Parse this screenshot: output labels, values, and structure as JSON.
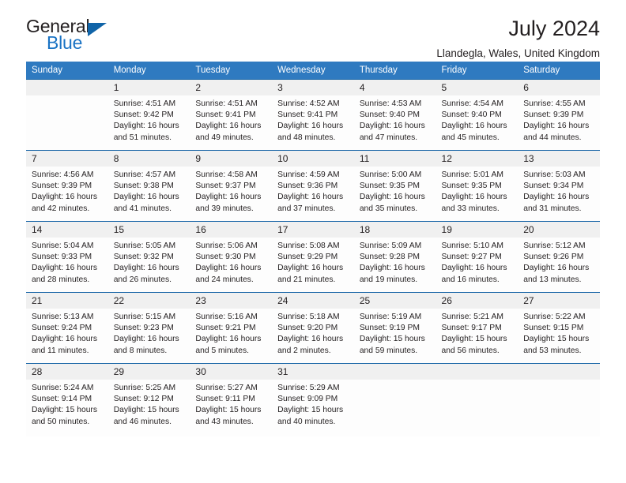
{
  "brand": {
    "name_part1": "General",
    "name_part2": "Blue",
    "triangle_color": "#1064a8",
    "blue_color": "#1a73c4"
  },
  "header": {
    "title": "July 2024",
    "subtitle": "Llandegla, Wales, United Kingdom"
  },
  "theme": {
    "header_row_bg": "#2f7ac0",
    "row_border": "#1764a6",
    "daynum_bg": "#f0f0f0",
    "text": "#231f20"
  },
  "labels": {
    "sunrise_prefix": "Sunrise:",
    "sunset_prefix": "Sunset:",
    "daylight_prefix": "Daylight:"
  },
  "weekdays": [
    "Sunday",
    "Monday",
    "Tuesday",
    "Wednesday",
    "Thursday",
    "Friday",
    "Saturday"
  ],
  "weeks": [
    [
      {
        "day": "",
        "sunrise": "",
        "sunset": "",
        "daylight_line1": "",
        "daylight_line2": ""
      },
      {
        "day": "1",
        "sunrise": "Sunrise: 4:51 AM",
        "sunset": "Sunset: 9:42 PM",
        "daylight_line1": "Daylight: 16 hours",
        "daylight_line2": "and 51 minutes."
      },
      {
        "day": "2",
        "sunrise": "Sunrise: 4:51 AM",
        "sunset": "Sunset: 9:41 PM",
        "daylight_line1": "Daylight: 16 hours",
        "daylight_line2": "and 49 minutes."
      },
      {
        "day": "3",
        "sunrise": "Sunrise: 4:52 AM",
        "sunset": "Sunset: 9:41 PM",
        "daylight_line1": "Daylight: 16 hours",
        "daylight_line2": "and 48 minutes."
      },
      {
        "day": "4",
        "sunrise": "Sunrise: 4:53 AM",
        "sunset": "Sunset: 9:40 PM",
        "daylight_line1": "Daylight: 16 hours",
        "daylight_line2": "and 47 minutes."
      },
      {
        "day": "5",
        "sunrise": "Sunrise: 4:54 AM",
        "sunset": "Sunset: 9:40 PM",
        "daylight_line1": "Daylight: 16 hours",
        "daylight_line2": "and 45 minutes."
      },
      {
        "day": "6",
        "sunrise": "Sunrise: 4:55 AM",
        "sunset": "Sunset: 9:39 PM",
        "daylight_line1": "Daylight: 16 hours",
        "daylight_line2": "and 44 minutes."
      }
    ],
    [
      {
        "day": "7",
        "sunrise": "Sunrise: 4:56 AM",
        "sunset": "Sunset: 9:39 PM",
        "daylight_line1": "Daylight: 16 hours",
        "daylight_line2": "and 42 minutes."
      },
      {
        "day": "8",
        "sunrise": "Sunrise: 4:57 AM",
        "sunset": "Sunset: 9:38 PM",
        "daylight_line1": "Daylight: 16 hours",
        "daylight_line2": "and 41 minutes."
      },
      {
        "day": "9",
        "sunrise": "Sunrise: 4:58 AM",
        "sunset": "Sunset: 9:37 PM",
        "daylight_line1": "Daylight: 16 hours",
        "daylight_line2": "and 39 minutes."
      },
      {
        "day": "10",
        "sunrise": "Sunrise: 4:59 AM",
        "sunset": "Sunset: 9:36 PM",
        "daylight_line1": "Daylight: 16 hours",
        "daylight_line2": "and 37 minutes."
      },
      {
        "day": "11",
        "sunrise": "Sunrise: 5:00 AM",
        "sunset": "Sunset: 9:35 PM",
        "daylight_line1": "Daylight: 16 hours",
        "daylight_line2": "and 35 minutes."
      },
      {
        "day": "12",
        "sunrise": "Sunrise: 5:01 AM",
        "sunset": "Sunset: 9:35 PM",
        "daylight_line1": "Daylight: 16 hours",
        "daylight_line2": "and 33 minutes."
      },
      {
        "day": "13",
        "sunrise": "Sunrise: 5:03 AM",
        "sunset": "Sunset: 9:34 PM",
        "daylight_line1": "Daylight: 16 hours",
        "daylight_line2": "and 31 minutes."
      }
    ],
    [
      {
        "day": "14",
        "sunrise": "Sunrise: 5:04 AM",
        "sunset": "Sunset: 9:33 PM",
        "daylight_line1": "Daylight: 16 hours",
        "daylight_line2": "and 28 minutes."
      },
      {
        "day": "15",
        "sunrise": "Sunrise: 5:05 AM",
        "sunset": "Sunset: 9:32 PM",
        "daylight_line1": "Daylight: 16 hours",
        "daylight_line2": "and 26 minutes."
      },
      {
        "day": "16",
        "sunrise": "Sunrise: 5:06 AM",
        "sunset": "Sunset: 9:30 PM",
        "daylight_line1": "Daylight: 16 hours",
        "daylight_line2": "and 24 minutes."
      },
      {
        "day": "17",
        "sunrise": "Sunrise: 5:08 AM",
        "sunset": "Sunset: 9:29 PM",
        "daylight_line1": "Daylight: 16 hours",
        "daylight_line2": "and 21 minutes."
      },
      {
        "day": "18",
        "sunrise": "Sunrise: 5:09 AM",
        "sunset": "Sunset: 9:28 PM",
        "daylight_line1": "Daylight: 16 hours",
        "daylight_line2": "and 19 minutes."
      },
      {
        "day": "19",
        "sunrise": "Sunrise: 5:10 AM",
        "sunset": "Sunset: 9:27 PM",
        "daylight_line1": "Daylight: 16 hours",
        "daylight_line2": "and 16 minutes."
      },
      {
        "day": "20",
        "sunrise": "Sunrise: 5:12 AM",
        "sunset": "Sunset: 9:26 PM",
        "daylight_line1": "Daylight: 16 hours",
        "daylight_line2": "and 13 minutes."
      }
    ],
    [
      {
        "day": "21",
        "sunrise": "Sunrise: 5:13 AM",
        "sunset": "Sunset: 9:24 PM",
        "daylight_line1": "Daylight: 16 hours",
        "daylight_line2": "and 11 minutes."
      },
      {
        "day": "22",
        "sunrise": "Sunrise: 5:15 AM",
        "sunset": "Sunset: 9:23 PM",
        "daylight_line1": "Daylight: 16 hours",
        "daylight_line2": "and 8 minutes."
      },
      {
        "day": "23",
        "sunrise": "Sunrise: 5:16 AM",
        "sunset": "Sunset: 9:21 PM",
        "daylight_line1": "Daylight: 16 hours",
        "daylight_line2": "and 5 minutes."
      },
      {
        "day": "24",
        "sunrise": "Sunrise: 5:18 AM",
        "sunset": "Sunset: 9:20 PM",
        "daylight_line1": "Daylight: 16 hours",
        "daylight_line2": "and 2 minutes."
      },
      {
        "day": "25",
        "sunrise": "Sunrise: 5:19 AM",
        "sunset": "Sunset: 9:19 PM",
        "daylight_line1": "Daylight: 15 hours",
        "daylight_line2": "and 59 minutes."
      },
      {
        "day": "26",
        "sunrise": "Sunrise: 5:21 AM",
        "sunset": "Sunset: 9:17 PM",
        "daylight_line1": "Daylight: 15 hours",
        "daylight_line2": "and 56 minutes."
      },
      {
        "day": "27",
        "sunrise": "Sunrise: 5:22 AM",
        "sunset": "Sunset: 9:15 PM",
        "daylight_line1": "Daylight: 15 hours",
        "daylight_line2": "and 53 minutes."
      }
    ],
    [
      {
        "day": "28",
        "sunrise": "Sunrise: 5:24 AM",
        "sunset": "Sunset: 9:14 PM",
        "daylight_line1": "Daylight: 15 hours",
        "daylight_line2": "and 50 minutes."
      },
      {
        "day": "29",
        "sunrise": "Sunrise: 5:25 AM",
        "sunset": "Sunset: 9:12 PM",
        "daylight_line1": "Daylight: 15 hours",
        "daylight_line2": "and 46 minutes."
      },
      {
        "day": "30",
        "sunrise": "Sunrise: 5:27 AM",
        "sunset": "Sunset: 9:11 PM",
        "daylight_line1": "Daylight: 15 hours",
        "daylight_line2": "and 43 minutes."
      },
      {
        "day": "31",
        "sunrise": "Sunrise: 5:29 AM",
        "sunset": "Sunset: 9:09 PM",
        "daylight_line1": "Daylight: 15 hours",
        "daylight_line2": "and 40 minutes."
      },
      {
        "day": "",
        "sunrise": "",
        "sunset": "",
        "daylight_line1": "",
        "daylight_line2": ""
      },
      {
        "day": "",
        "sunrise": "",
        "sunset": "",
        "daylight_line1": "",
        "daylight_line2": ""
      },
      {
        "day": "",
        "sunrise": "",
        "sunset": "",
        "daylight_line1": "",
        "daylight_line2": ""
      }
    ]
  ]
}
